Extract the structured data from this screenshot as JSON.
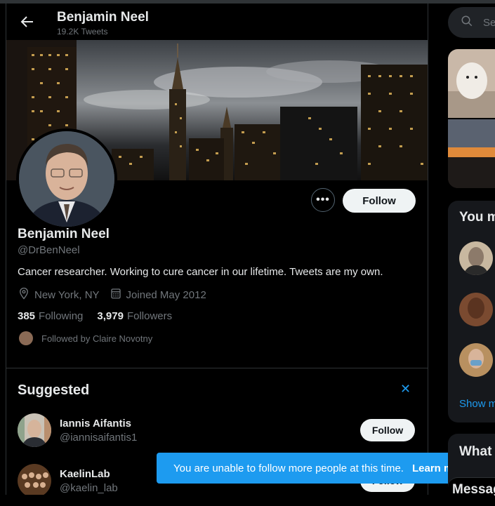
{
  "header": {
    "name": "Benjamin Neel",
    "tweet_count": "19.2K Tweets"
  },
  "profile": {
    "name": "Benjamin Neel",
    "handle": "@DrBenNeel",
    "bio": "Cancer researcher. Working to cure cancer in our lifetime. Tweets are my own.",
    "location": "New York, NY",
    "joined": "Joined May 2012",
    "following_count": "385",
    "following_label": "Following",
    "followers_count": "3,979",
    "followers_label": "Followers",
    "followed_by": "Followed by Claire Novotny",
    "follow_label": "Follow",
    "more_label": "•••"
  },
  "suggested": {
    "title": "Suggested",
    "close_label": "✕",
    "items": [
      {
        "name": "Iannis Aifantis",
        "handle": "@iannisaifantis1",
        "follow_label": "Follow"
      },
      {
        "name": "KaelinLab",
        "handle": "@kaelin_lab",
        "follow_label": "Follow"
      }
    ]
  },
  "toast": {
    "message": "You are unable to follow more people at this time.",
    "link": "Learn more"
  },
  "sidebar": {
    "search_placeholder": "Se",
    "wtf_title": "You m",
    "show_more": "Show m",
    "whats_title": "What",
    "messages_title": "Messag"
  },
  "colors": {
    "accent": "#1d9bf0",
    "background": "#000000",
    "button": "#eff3f4"
  },
  "icons": [
    "back-arrow-icon",
    "more-icon",
    "location-icon",
    "calendar-icon",
    "close-icon",
    "search-icon"
  ]
}
